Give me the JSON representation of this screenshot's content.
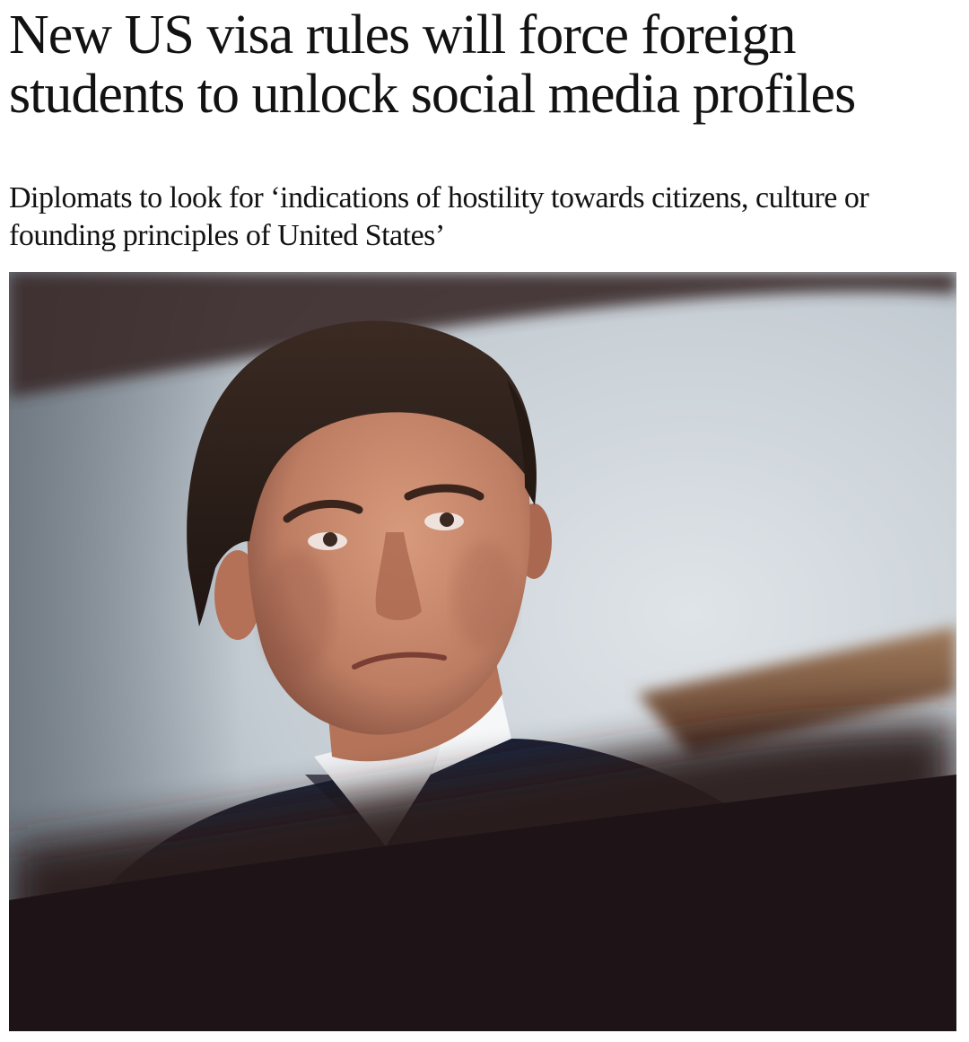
{
  "article": {
    "headline": "New US visa rules will force foreign students to unlock social media profiles",
    "standfirst": "Diplomats to look for ‘indications of hostility towards citizens, culture or founding principles of United States’"
  },
  "photo": {
    "subject": "man in dark suit with white shirt looking upward, blurred desk edge in foreground",
    "colors": {
      "background": "#c3cbd2",
      "suit": "#1c2338",
      "shirt": "#eef0f3",
      "skin": "#c4876c",
      "hair": "#2b1d17",
      "foreground_blur": "#2a1a1d",
      "wood_bar": "#7b5640"
    }
  }
}
